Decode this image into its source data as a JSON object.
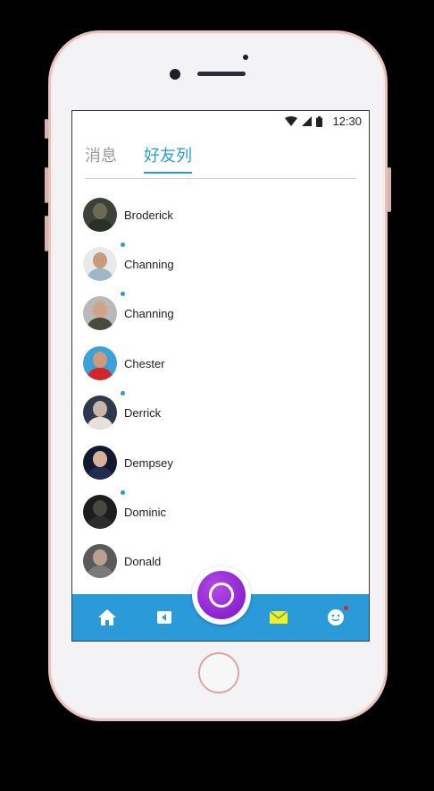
{
  "status_bar": {
    "time": "12:30"
  },
  "tabs": [
    {
      "label": "消息",
      "active": false
    },
    {
      "label": "好友列",
      "active": true
    }
  ],
  "friends": [
    {
      "name": "Broderick",
      "online": false
    },
    {
      "name": "Channing",
      "online": true
    },
    {
      "name": "Channing",
      "online": true
    },
    {
      "name": "Chester",
      "online": false
    },
    {
      "name": "Derrick",
      "online": true
    },
    {
      "name": "Dempsey",
      "online": false
    },
    {
      "name": "Dominic",
      "online": true
    },
    {
      "name": "Donald",
      "online": false
    }
  ],
  "bottom_nav": [
    {
      "icon": "home-icon"
    },
    {
      "icon": "back-icon"
    },
    {
      "icon": "record-button"
    },
    {
      "icon": "mail-icon"
    },
    {
      "icon": "smiley-icon",
      "badge": true
    }
  ],
  "colors": {
    "accent": "#2a9ad8",
    "fab": "#8a18d6",
    "mail_icon": "#f4f01a",
    "badge": "#e02020"
  }
}
